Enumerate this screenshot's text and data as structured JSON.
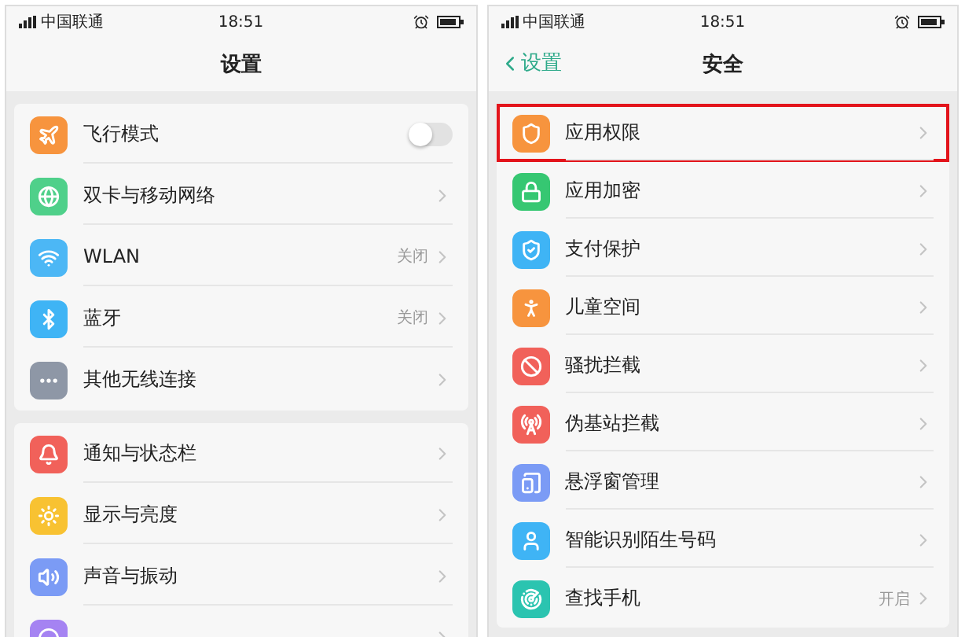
{
  "screens": [
    {
      "status_bar": {
        "carrier": "中国联通",
        "time": "18:51"
      },
      "nav": {
        "title": "设置"
      },
      "groups": [
        {
          "rows": [
            {
              "label": "飞行模式",
              "color": "#f7943e",
              "kind": "toggle",
              "on": false
            },
            {
              "label": "双卡与移动网络",
              "color": "#4fd08a",
              "kind": "link"
            },
            {
              "label": "WLAN",
              "color": "#4cb7f5",
              "kind": "link",
              "value": "关闭"
            },
            {
              "label": "蓝牙",
              "color": "#3fb4f5",
              "kind": "link",
              "value": "关闭"
            },
            {
              "label": "其他无线连接",
              "color": "#8e97a6",
              "kind": "link"
            }
          ]
        },
        {
          "rows": [
            {
              "label": "通知与状态栏",
              "color": "#f1615a",
              "kind": "link"
            },
            {
              "label": "显示与亮度",
              "color": "#f8c232",
              "kind": "link"
            },
            {
              "label": "声音与振动",
              "color": "#7b9bf5",
              "kind": "link"
            },
            {
              "color": "#a583f2",
              "kind": "link"
            }
          ]
        }
      ]
    },
    {
      "status_bar": {
        "carrier": "中国联通",
        "time": "18:51"
      },
      "nav": {
        "back": "设置",
        "title": "安全"
      },
      "groups": [
        {
          "rows": [
            {
              "label": "应用权限",
              "color": "#f7943e",
              "kind": "link",
              "selected": true
            },
            {
              "label": "应用加密",
              "color": "#36c772",
              "kind": "link",
              "selected": false
            },
            {
              "label": "支付保护",
              "color": "#3fb4f5",
              "kind": "link",
              "selected": false
            },
            {
              "label": "儿童空间",
              "color": "#f7943e",
              "kind": "link",
              "selected": false
            },
            {
              "label": "骚扰拦截",
              "color": "#f1615a",
              "kind": "link",
              "selected": false
            },
            {
              "label": "伪基站拦截",
              "color": "#f1615a",
              "kind": "link",
              "selected": false
            },
            {
              "label": "悬浮窗管理",
              "color": "#7b9bf5",
              "kind": "link",
              "selected": false
            },
            {
              "label": "智能识别陌生号码",
              "color": "#3fb4f5",
              "kind": "link",
              "selected": false
            },
            {
              "label": "查找手机",
              "color": "#2bc4b0",
              "kind": "link",
              "value": "开启",
              "selected": false
            }
          ]
        }
      ]
    }
  ]
}
